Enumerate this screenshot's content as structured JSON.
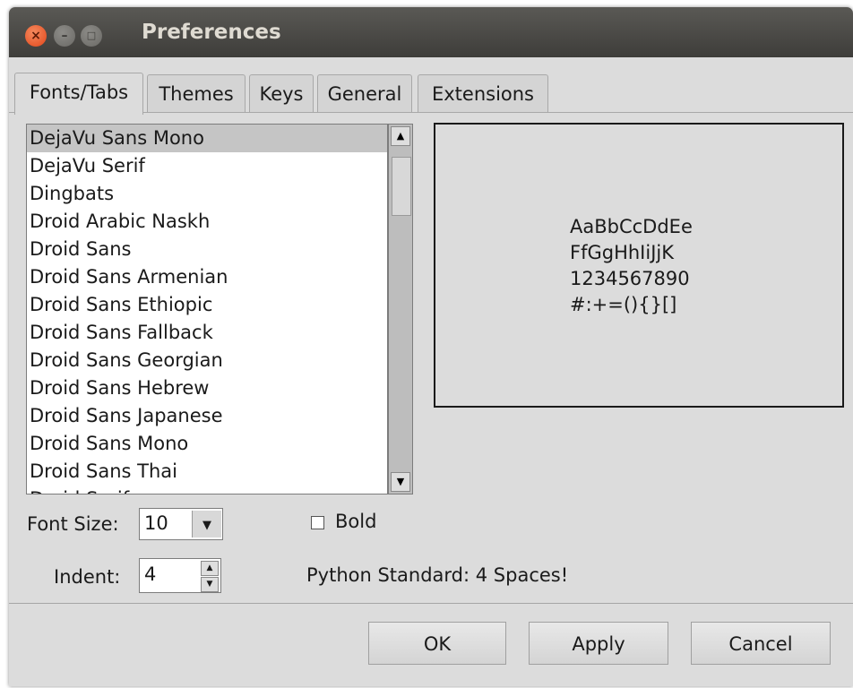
{
  "window": {
    "title": "Preferences"
  },
  "tabs": [
    {
      "label": "Fonts/Tabs"
    },
    {
      "label": "Themes"
    },
    {
      "label": "Keys"
    },
    {
      "label": "General"
    },
    {
      "label": "Extensions"
    }
  ],
  "font_list": {
    "selected": "DejaVu Sans Mono",
    "items": [
      "DejaVu Sans Mono",
      "DejaVu Serif",
      "Dingbats",
      "Droid Arabic Naskh",
      "Droid Sans",
      "Droid Sans Armenian",
      "Droid Sans Ethiopic",
      "Droid Sans Fallback",
      "Droid Sans Georgian",
      "Droid Sans Hebrew",
      "Droid Sans Japanese",
      "Droid Sans Mono",
      "Droid Sans Thai",
      "Droid Serif"
    ]
  },
  "sample": {
    "lines": [
      "AaBbCcDdEe",
      "FfGgHhIiJjK",
      "1234567890",
      "#:+=(){}[]"
    ]
  },
  "font_size": {
    "label": "Font Size:",
    "value": "10"
  },
  "bold": {
    "label": "Bold",
    "checked": false
  },
  "indent": {
    "label": "Indent:",
    "value": "4",
    "hint": "Python Standard: 4 Spaces!"
  },
  "buttons": {
    "ok": "OK",
    "apply": "Apply",
    "cancel": "Cancel"
  },
  "colors": {
    "titlebar": "#45443f",
    "close_button": "#e95420",
    "window_bg": "#dcdcdc",
    "selection": "#c5c5c5"
  }
}
